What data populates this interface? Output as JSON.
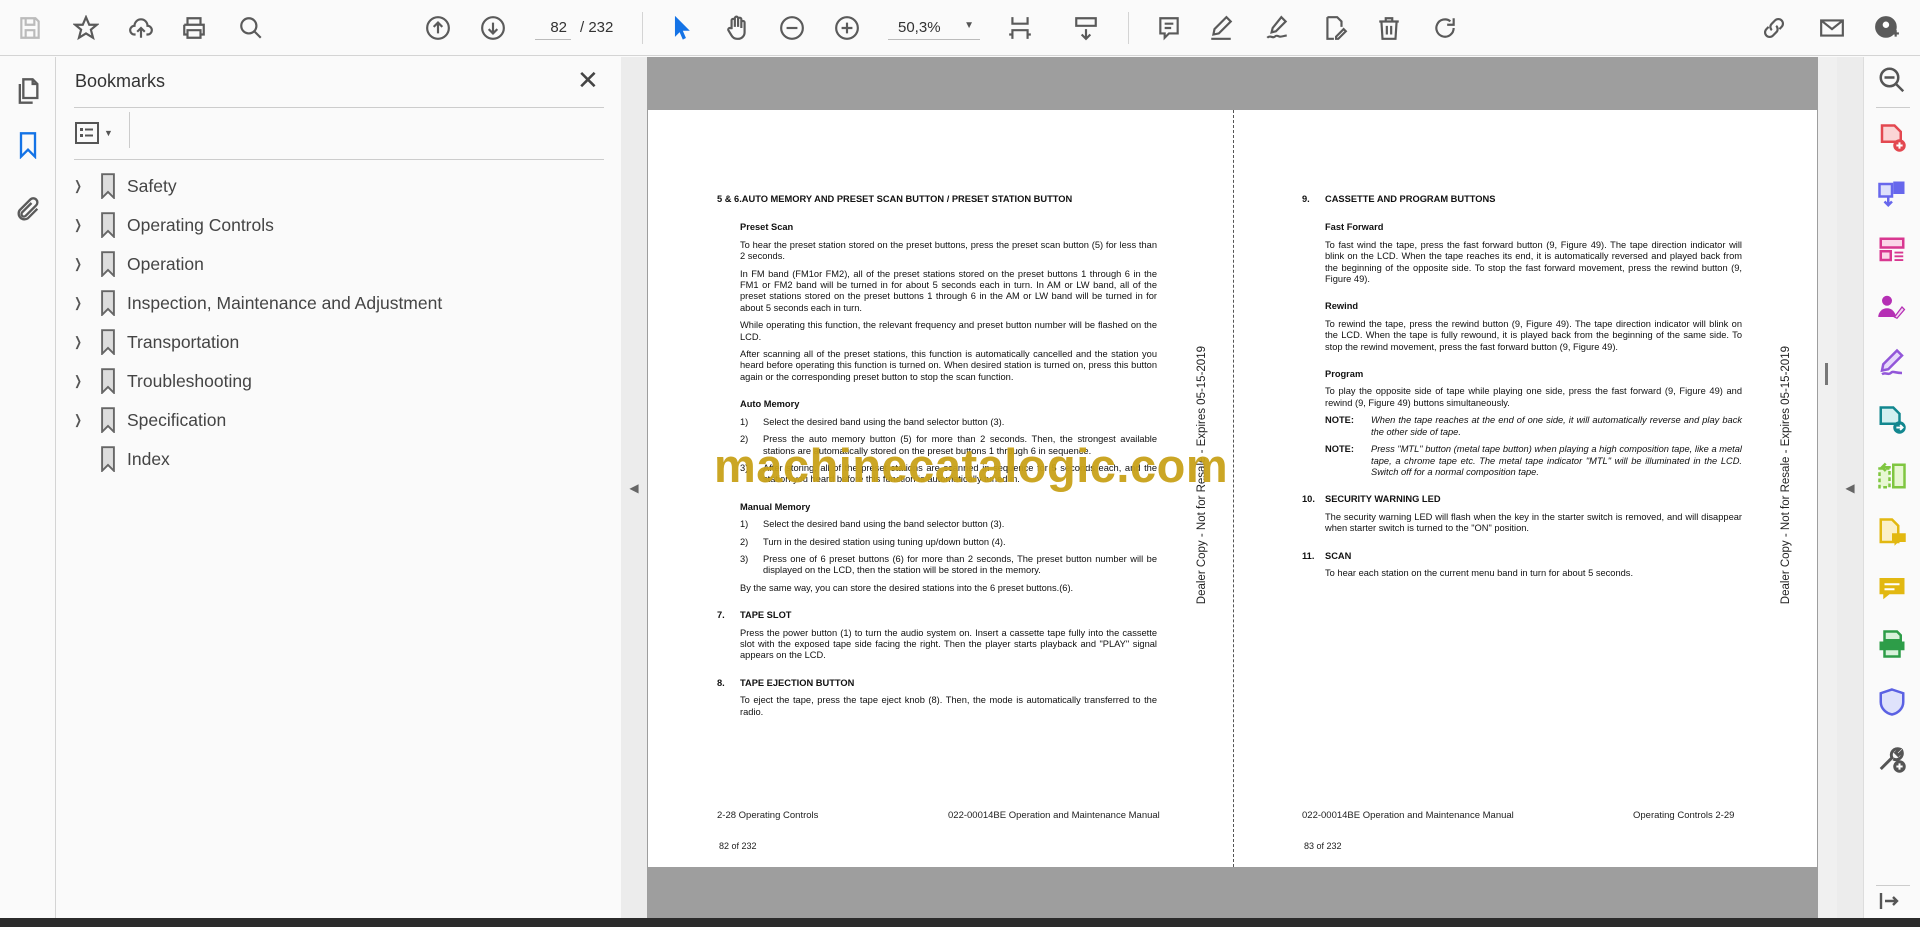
{
  "toolbar": {
    "current_page": "82",
    "total_pages": "/ 232",
    "zoom": "50,3%",
    "icons": [
      "save-icon",
      "bookmark-star-icon",
      "upload-icon",
      "print-icon",
      "find-icon",
      "prev-page-icon",
      "next-page-icon",
      "select-pointer-icon",
      "hand-icon",
      "zoom-out-icon",
      "zoom-in-icon",
      "fit-page-icon",
      "scroll-mode-icon",
      "comment-icon",
      "highlight-icon",
      "sign-icon",
      "fill-sign-icon",
      "delete-icon",
      "rotate-icon",
      "share-link-icon",
      "email-icon",
      "account-icon"
    ]
  },
  "sidebar": {
    "title": "Bookmarks",
    "bookmarks": [
      {
        "label": "Safety",
        "expandable": true
      },
      {
        "label": "Operating Controls",
        "expandable": true
      },
      {
        "label": "Operation",
        "expandable": true
      },
      {
        "label": "Inspection, Maintenance and Adjustment",
        "expandable": true
      },
      {
        "label": "Transportation",
        "expandable": true
      },
      {
        "label": "Troubleshooting",
        "expandable": true
      },
      {
        "label": "Specification",
        "expandable": true
      },
      {
        "label": "Index",
        "expandable": false
      }
    ]
  },
  "left_page": {
    "heading": "5 & 6.AUTO MEMORY AND PRESET SCAN BUTTON / PRESET STATION BUTTON",
    "preset_scan_title": "Preset Scan",
    "preset_scan_paras": [
      "To hear the preset station stored on the preset buttons, press the preset scan button (5) for less than 2 seconds.",
      "In FM band (FM1or FM2), all of the preset stations stored on the preset buttons 1 through 6 in the FM1 or FM2 band will be turned in for about 5 seconds each in turn. In AM or LW band, all of the preset stations stored on the preset buttons 1 through 6 in the AM or LW band will be turned in for about 5 seconds each in turn.",
      "While operating this function, the relevant frequency and preset button number will be flashed on the LCD.",
      "After scanning all of the preset stations, this function is automatically cancelled and the station you heard before operating this function is turned on. When desired station is turned on, press this button again or the corresponding preset button to stop the scan function."
    ],
    "auto_memory_title": "Auto Memory",
    "auto_memory_items": [
      {
        "n": "1)",
        "t": "Select the desired band using the band selector button (3)."
      },
      {
        "n": "2)",
        "t": "Press the auto memory button (5) for more than 2 seconds. Then, the strongest available stations are automatically stored on the preset buttons 1 through 6 in sequence."
      },
      {
        "n": "3)",
        "t": "After storing, all of the preset stations are scanned in sequence for 5 seconds each, and the station you heard before this function is automatically tuned in."
      }
    ],
    "manual_memory_title": "Manual Memory",
    "manual_memory_items": [
      {
        "n": "1)",
        "t": "Select the desired band using the band selector button (3)."
      },
      {
        "n": "2)",
        "t": "Turn in the desired station using tuning up/down button (4)."
      },
      {
        "n": "3)",
        "t": "Press one of 6 preset buttons (6) for more than 2 seconds, The preset button number will be displayed on the LCD, then the station will be stored in the memory."
      }
    ],
    "manual_memory_note": "By the same way, you can store the desired stations into the 6 preset buttons.(6).",
    "s7_num": "7.",
    "s7_title": "TAPE SLOT",
    "s7_text": "Press the power button (1) to turn the audio system on. Insert a cassette tape fully into the cassette slot with the exposed tape side facing the right. Then the player starts playback and \"PLAY\" signal appears on the LCD.",
    "s8_num": "8.",
    "s8_title": "TAPE EJECTION BUTTON",
    "s8_text": "To eject the tape, press the tape eject knob (8). Then, the mode is automatically transferred to the radio.",
    "footer_left": "2-28  Operating Controls",
    "footer_right": "022-00014BE Operation and Maintenance Manual",
    "page_counter": "82 of 232",
    "side_stamp": "Dealer Copy - Not for Resale - Expires 05-15-2019"
  },
  "right_page": {
    "s9_num": "9.",
    "s9_title": "CASSETTE AND PROGRAM BUTTONS",
    "ff_title": "Fast Forward",
    "ff_text": "To fast wind the tape, press the fast forward button (9, Figure 49). The tape direction indicator will blink on the LCD. When the tape reaches its end, it is automatically reversed and played back from the beginning of the opposite side. To stop the fast forward movement, press the rewind button (9, Figure 49).",
    "rw_title": "Rewind",
    "rw_text": "To rewind the tape, press the rewind button (9, Figure 49). The tape direction indicator will blink on the LCD. When the tape is fully rewound, it is played back from the beginning of the same side. To stop the rewind movement, press the fast forward button (9, Figure 49).",
    "prog_title": "Program",
    "prog_text": "To play the opposite side of tape while playing one side, press the fast forward (9, Figure 49) and rewind (9, Figure 49) buttons simultaneously.",
    "notes": [
      {
        "label": "NOTE:",
        "text": "When the tape reaches at the end of one side, it will automatically reverse and play back the other side of tape."
      },
      {
        "label": "NOTE:",
        "text": "Press \"MTL\" button (metal tape button) when playing a high composition tape, like a metal tape, a chrome tape etc. The metal tape indicator \"MTL\" will be illuminated in the LCD. Switch off for a normal composition tape."
      }
    ],
    "s10_num": "10.",
    "s10_title": "SECURITY WARNING LED",
    "s10_text": "The security warning LED will flash when the key in the starter switch is removed, and will disappear when starter switch is turned to the \"ON\" position.",
    "s11_num": "11.",
    "s11_title": "SCAN",
    "s11_text": "To hear each station on the current menu band in turn for about 5 seconds.",
    "footer_left": "022-00014BE Operation and Maintenance Manual",
    "footer_right": "Operating Controls 2-29",
    "page_counter": "83 of 232",
    "side_stamp": "Dealer Copy - Not for Resale - Expires 05-15-2019"
  },
  "watermark": "machinecatalogic.com",
  "tools_panel": [
    "search-tools-icon",
    "create-pdf-icon",
    "export-pdf-icon",
    "organize-pages-icon",
    "request-signatures-icon",
    "fill-sign-icon",
    "send-for-review-icon",
    "compare-files-icon",
    "share-comment-icon",
    "comment-icon",
    "print-production-icon",
    "protect-icon",
    "more-tools-icon",
    "collapse-panel-icon"
  ],
  "colors": {
    "accent": "#1473e6",
    "watermark": "#c9a21a"
  }
}
